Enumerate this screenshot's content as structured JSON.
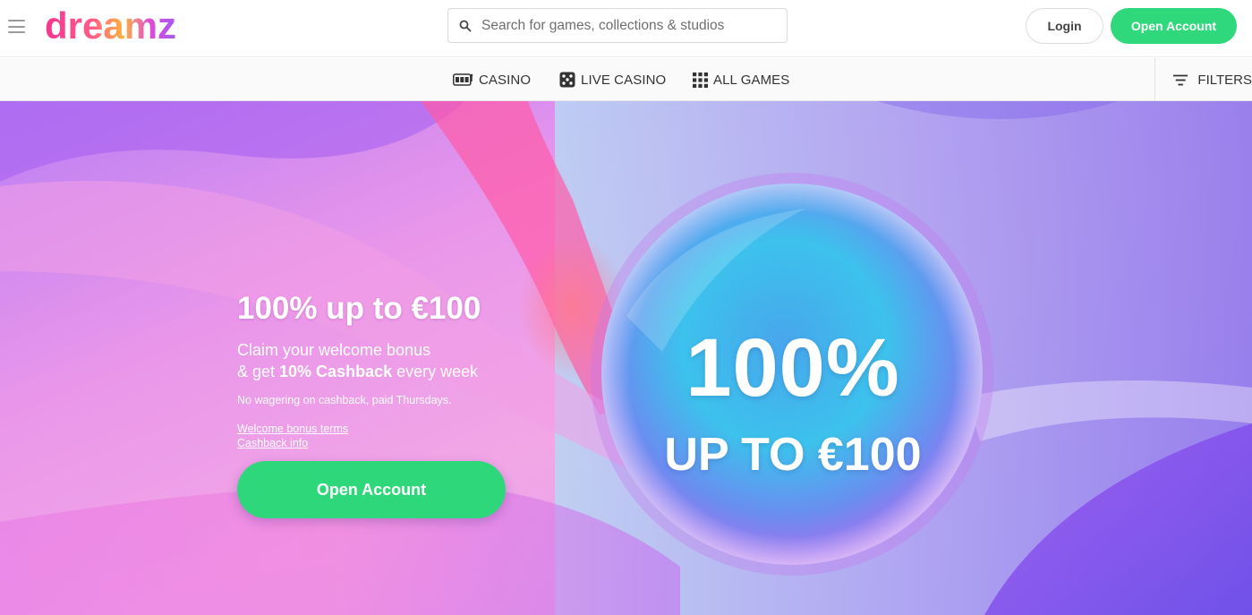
{
  "header": {
    "logo_text": "dreamz",
    "search_placeholder": "Search for games, collections & studios",
    "login_label": "Login",
    "open_account_label": "Open Account"
  },
  "nav": {
    "items": [
      {
        "label": "CASINO",
        "icon": "slot-machine-icon"
      },
      {
        "label": "LIVE CASINO",
        "icon": "dice-icon"
      },
      {
        "label": "ALL GAMES",
        "icon": "grid-icon"
      }
    ],
    "filters_label": "FILTERS"
  },
  "hero": {
    "title": "100% up to €100",
    "line1": "Claim your welcome bonus",
    "line2_prefix": "& get ",
    "line2_bold": "10% Cashback",
    "line2_suffix": " every week",
    "note": "No wagering on cashback, paid Thursdays.",
    "link_terms": "Welcome bonus terms",
    "link_cashback": "Cashback info",
    "cta_label": "Open Account",
    "bubble_big": "100%",
    "bubble_sub": "UP TO €100"
  },
  "colors": {
    "accent_green": "#2fd87a",
    "hero_pink": "#ec6fe6",
    "hero_purple": "#9a5cf2",
    "hero_cyan": "#38c8ee"
  }
}
